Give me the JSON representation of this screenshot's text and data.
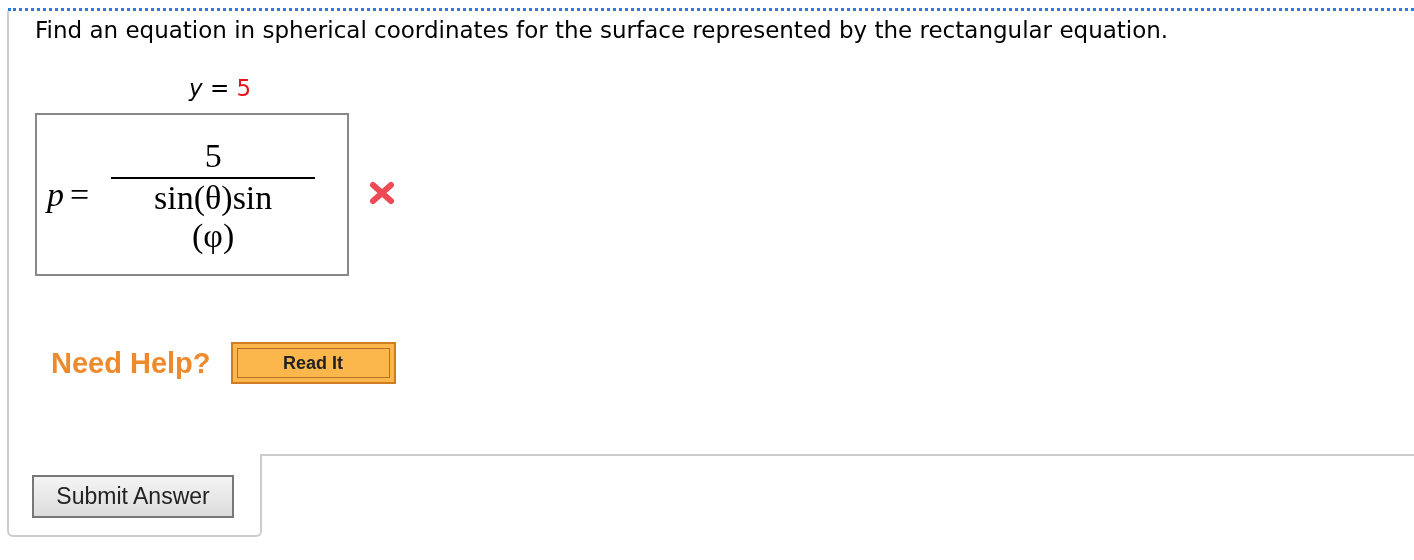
{
  "question": "Find an equation in spherical coordinates for the surface represented by the rectangular equation.",
  "given_equation": {
    "variable": "y",
    "equals": "=",
    "value": "5"
  },
  "answer": {
    "lhs": "p",
    "equals": "=",
    "numerator": "5",
    "denominator": [
      "sin(θ)sin",
      "(φ)"
    ],
    "correct": false
  },
  "help": {
    "label": "Need Help?",
    "buttons": [
      "Read It"
    ]
  },
  "submit_button": "Submit Answer"
}
